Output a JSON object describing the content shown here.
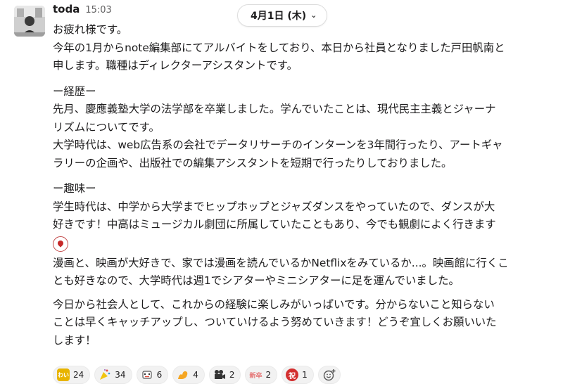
{
  "message": {
    "author": "toda",
    "time": "15:03",
    "paragraphs": [
      "お疲れ様です。",
      "今年の1月からnote編集部にてアルバイトをしており、本日から社員となりました戸田帆南と",
      "申します。職種はディレクターアシスタントです。",
      "ー経歴ー",
      "先月、慶應義塾大学の法学部を卒業しました。学んでいたことは、現代民主主義とジャーナ",
      "リズムについてです。",
      "大学時代は、web広告系の会社でデータリサーチのインターンを3年間行ったり、アートギャ",
      "ラリーの企画や、出版社での編集アシスタントを短期で行ったりしておりました。",
      "ー趣味ー",
      "学生時代は、中学から大学までヒップホップとジャズダンスをやっていたので、ダンスが大",
      "好きです！中高はミュージカル劇団に所属していたこともあり、今でも観劇によく行きます",
      "漫画と、映画が大好きで、家では漫画を読んでいるかNetflixをみているか...。映画館に行くこ",
      "とも好きなので、大学時代は週1でシアターやミニシアターに足を運んでいました。",
      "今日から社会人として、これからの経験に楽しみがいっぱいです。分からないこと知らない",
      "ことは早くキャッチアップし、ついていけるよう努めていきます！どうぞ宜しくお願いいた",
      "します！"
    ]
  },
  "date_divider": {
    "label": "4月1日 (木)"
  },
  "reactions": [
    {
      "icon": "waiwai-icon",
      "color": "#e8b400",
      "glyph": "わい",
      "count": "24"
    },
    {
      "icon": "party-popper-icon",
      "color": "#f1c40f",
      "glyph": "🎉",
      "count": "34"
    },
    {
      "icon": "robot-icon",
      "color": "#8f9bb3",
      "glyph": "◫",
      "count": "6"
    },
    {
      "icon": "muscle-icon",
      "color": "#f5a623",
      "glyph": "💪",
      "count": "4"
    },
    {
      "icon": "movie-camera-icon",
      "color": "#333333",
      "glyph": "🎥",
      "count": "2"
    },
    {
      "icon": "shinsotsu-icon",
      "color": "#e57373",
      "glyph": "新卒",
      "count": "2"
    },
    {
      "icon": "celebration-kanji-icon",
      "color": "#d32f2f",
      "glyph": "祝",
      "count": "1"
    }
  ]
}
